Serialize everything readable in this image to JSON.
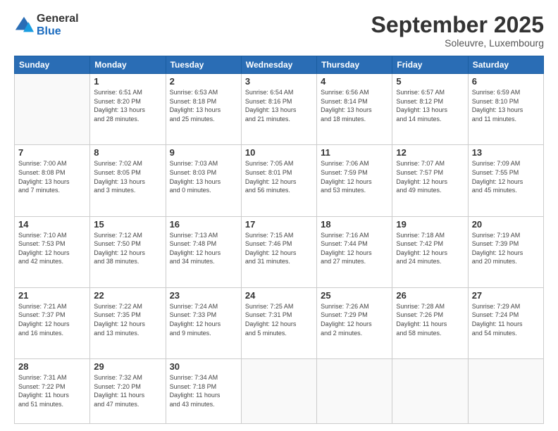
{
  "logo": {
    "general": "General",
    "blue": "Blue"
  },
  "header": {
    "month": "September 2025",
    "location": "Soleuvre, Luxembourg"
  },
  "days": [
    "Sunday",
    "Monday",
    "Tuesday",
    "Wednesday",
    "Thursday",
    "Friday",
    "Saturday"
  ],
  "weeks": [
    [
      {
        "day": "",
        "info": ""
      },
      {
        "day": "1",
        "info": "Sunrise: 6:51 AM\nSunset: 8:20 PM\nDaylight: 13 hours\nand 28 minutes."
      },
      {
        "day": "2",
        "info": "Sunrise: 6:53 AM\nSunset: 8:18 PM\nDaylight: 13 hours\nand 25 minutes."
      },
      {
        "day": "3",
        "info": "Sunrise: 6:54 AM\nSunset: 8:16 PM\nDaylight: 13 hours\nand 21 minutes."
      },
      {
        "day": "4",
        "info": "Sunrise: 6:56 AM\nSunset: 8:14 PM\nDaylight: 13 hours\nand 18 minutes."
      },
      {
        "day": "5",
        "info": "Sunrise: 6:57 AM\nSunset: 8:12 PM\nDaylight: 13 hours\nand 14 minutes."
      },
      {
        "day": "6",
        "info": "Sunrise: 6:59 AM\nSunset: 8:10 PM\nDaylight: 13 hours\nand 11 minutes."
      }
    ],
    [
      {
        "day": "7",
        "info": "Sunrise: 7:00 AM\nSunset: 8:08 PM\nDaylight: 13 hours\nand 7 minutes."
      },
      {
        "day": "8",
        "info": "Sunrise: 7:02 AM\nSunset: 8:05 PM\nDaylight: 13 hours\nand 3 minutes."
      },
      {
        "day": "9",
        "info": "Sunrise: 7:03 AM\nSunset: 8:03 PM\nDaylight: 13 hours\nand 0 minutes."
      },
      {
        "day": "10",
        "info": "Sunrise: 7:05 AM\nSunset: 8:01 PM\nDaylight: 12 hours\nand 56 minutes."
      },
      {
        "day": "11",
        "info": "Sunrise: 7:06 AM\nSunset: 7:59 PM\nDaylight: 12 hours\nand 53 minutes."
      },
      {
        "day": "12",
        "info": "Sunrise: 7:07 AM\nSunset: 7:57 PM\nDaylight: 12 hours\nand 49 minutes."
      },
      {
        "day": "13",
        "info": "Sunrise: 7:09 AM\nSunset: 7:55 PM\nDaylight: 12 hours\nand 45 minutes."
      }
    ],
    [
      {
        "day": "14",
        "info": "Sunrise: 7:10 AM\nSunset: 7:53 PM\nDaylight: 12 hours\nand 42 minutes."
      },
      {
        "day": "15",
        "info": "Sunrise: 7:12 AM\nSunset: 7:50 PM\nDaylight: 12 hours\nand 38 minutes."
      },
      {
        "day": "16",
        "info": "Sunrise: 7:13 AM\nSunset: 7:48 PM\nDaylight: 12 hours\nand 34 minutes."
      },
      {
        "day": "17",
        "info": "Sunrise: 7:15 AM\nSunset: 7:46 PM\nDaylight: 12 hours\nand 31 minutes."
      },
      {
        "day": "18",
        "info": "Sunrise: 7:16 AM\nSunset: 7:44 PM\nDaylight: 12 hours\nand 27 minutes."
      },
      {
        "day": "19",
        "info": "Sunrise: 7:18 AM\nSunset: 7:42 PM\nDaylight: 12 hours\nand 24 minutes."
      },
      {
        "day": "20",
        "info": "Sunrise: 7:19 AM\nSunset: 7:39 PM\nDaylight: 12 hours\nand 20 minutes."
      }
    ],
    [
      {
        "day": "21",
        "info": "Sunrise: 7:21 AM\nSunset: 7:37 PM\nDaylight: 12 hours\nand 16 minutes."
      },
      {
        "day": "22",
        "info": "Sunrise: 7:22 AM\nSunset: 7:35 PM\nDaylight: 12 hours\nand 13 minutes."
      },
      {
        "day": "23",
        "info": "Sunrise: 7:24 AM\nSunset: 7:33 PM\nDaylight: 12 hours\nand 9 minutes."
      },
      {
        "day": "24",
        "info": "Sunrise: 7:25 AM\nSunset: 7:31 PM\nDaylight: 12 hours\nand 5 minutes."
      },
      {
        "day": "25",
        "info": "Sunrise: 7:26 AM\nSunset: 7:29 PM\nDaylight: 12 hours\nand 2 minutes."
      },
      {
        "day": "26",
        "info": "Sunrise: 7:28 AM\nSunset: 7:26 PM\nDaylight: 11 hours\nand 58 minutes."
      },
      {
        "day": "27",
        "info": "Sunrise: 7:29 AM\nSunset: 7:24 PM\nDaylight: 11 hours\nand 54 minutes."
      }
    ],
    [
      {
        "day": "28",
        "info": "Sunrise: 7:31 AM\nSunset: 7:22 PM\nDaylight: 11 hours\nand 51 minutes."
      },
      {
        "day": "29",
        "info": "Sunrise: 7:32 AM\nSunset: 7:20 PM\nDaylight: 11 hours\nand 47 minutes."
      },
      {
        "day": "30",
        "info": "Sunrise: 7:34 AM\nSunset: 7:18 PM\nDaylight: 11 hours\nand 43 minutes."
      },
      {
        "day": "",
        "info": ""
      },
      {
        "day": "",
        "info": ""
      },
      {
        "day": "",
        "info": ""
      },
      {
        "day": "",
        "info": ""
      }
    ]
  ]
}
